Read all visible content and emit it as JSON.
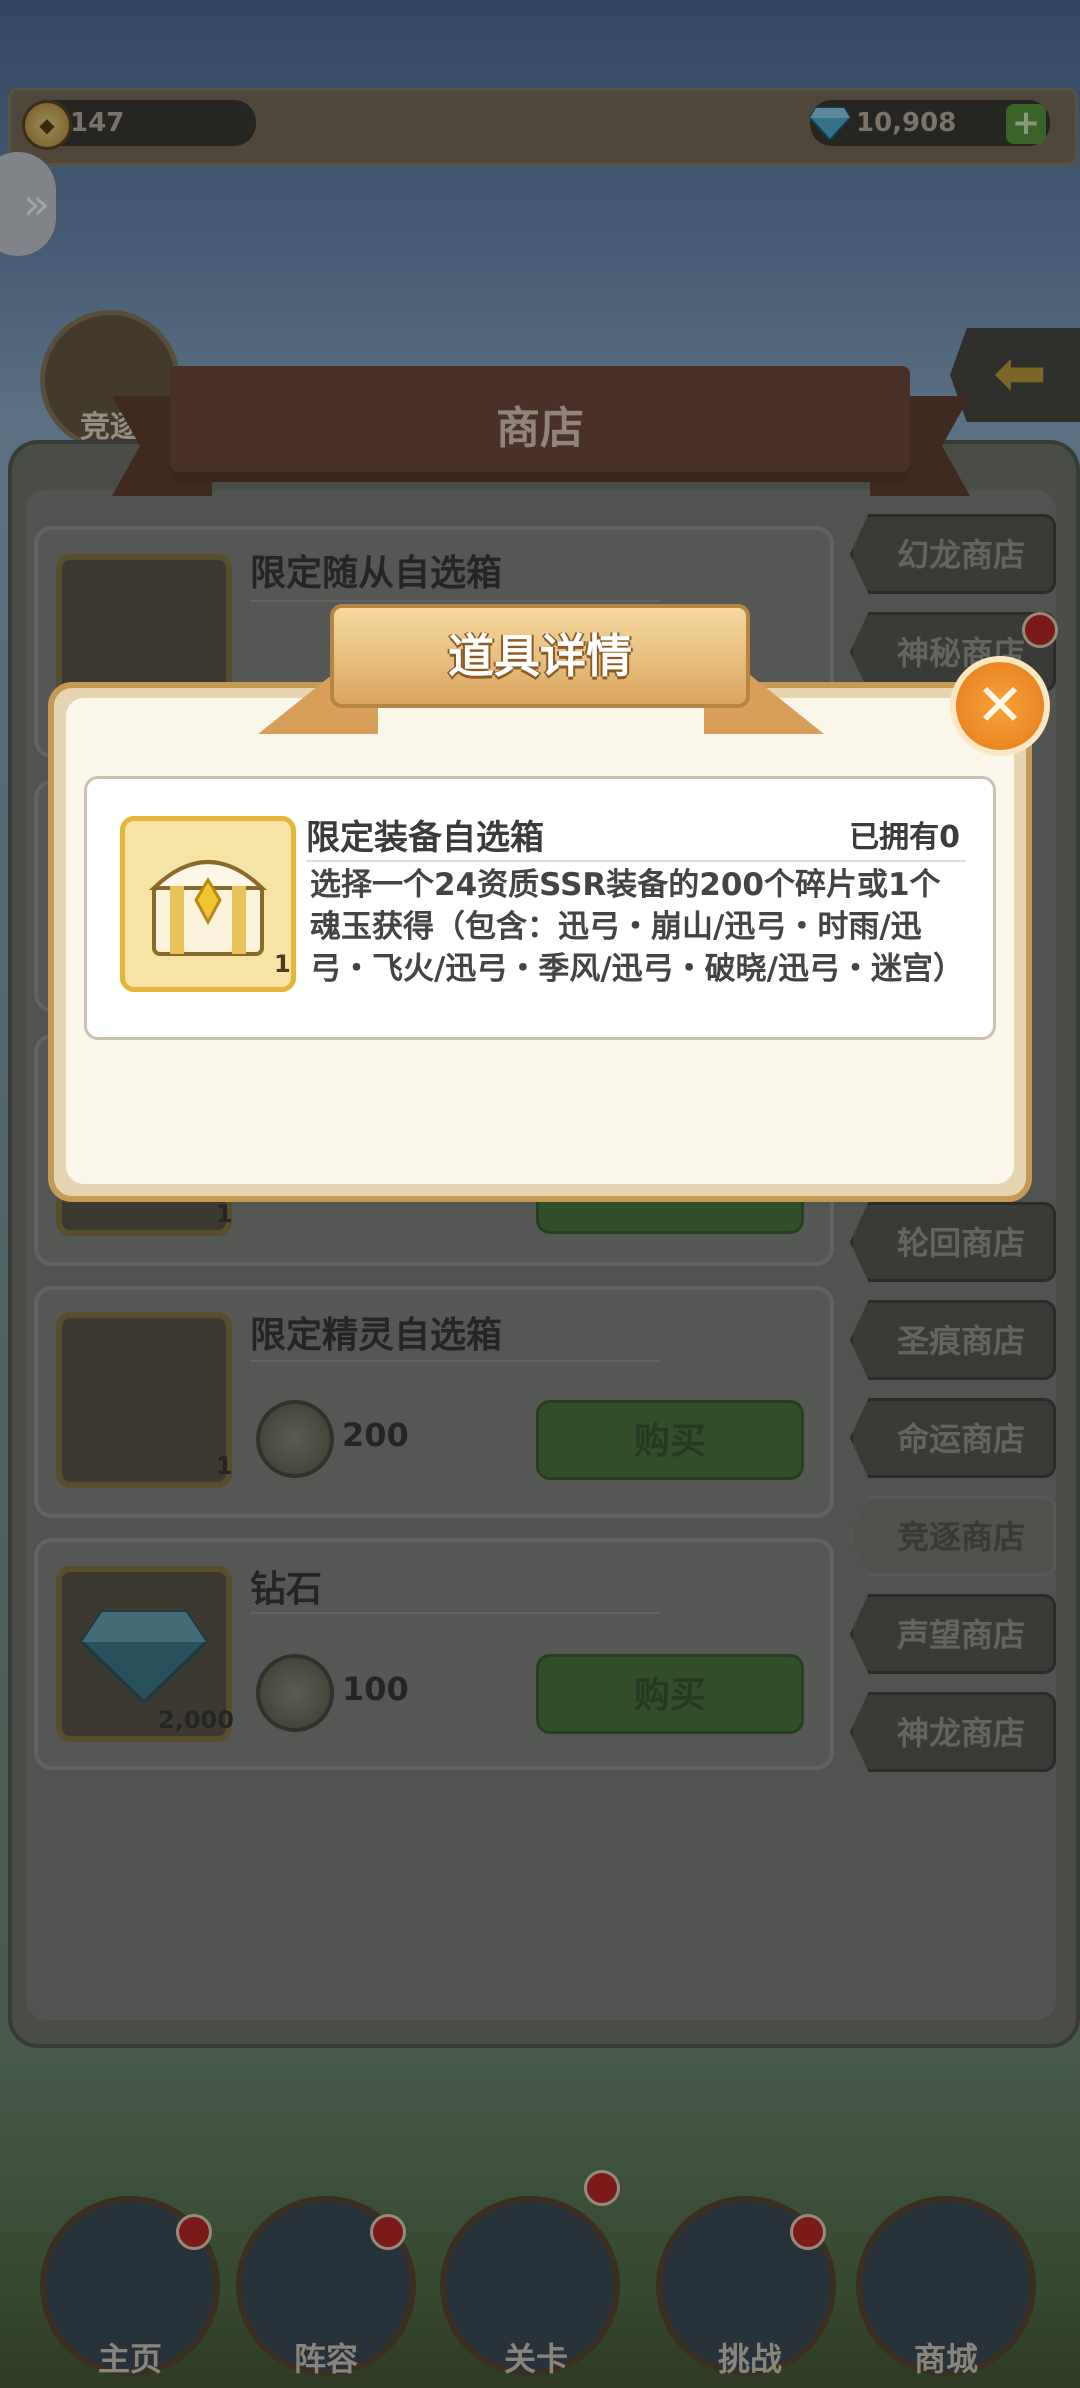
{
  "top_bar": {
    "currency_1": "147",
    "currency_2": "10,908",
    "add_symbol": "+"
  },
  "compete_badge_label": "竞逐",
  "shop": {
    "title": "商店",
    "items": [
      {
        "name": "限定随从自选箱"
      },
      {
        "name": "限定精灵自选箱",
        "qty": "1",
        "price": "200",
        "buy_label": "购买"
      },
      {
        "name": "钻石",
        "qty": "2,000",
        "price": "100",
        "buy_label": "购买"
      }
    ],
    "hidden_item_qty": "1"
  },
  "tabs": [
    {
      "label": "幻龙商店"
    },
    {
      "label": "神秘商店"
    },
    {
      "label": "轮回商店"
    },
    {
      "label": "圣痕商店"
    },
    {
      "label": "命运商店"
    },
    {
      "label": "竞逐商店"
    },
    {
      "label": "声望商店"
    },
    {
      "label": "神龙商店"
    }
  ],
  "modal": {
    "title": "道具详情",
    "item_name": "限定装备自选箱",
    "owned": "已拥有0",
    "description": "选择一个24资质SSR装备的200个碎片或1个魂玉获得（包含：迅弓・崩山/迅弓・时雨/迅弓・飞火/迅弓・季风/迅弓・破晓/迅弓・迷宫）",
    "item_qty": "1",
    "close_symbol": "✕"
  },
  "bottom_nav": [
    {
      "label": "主页"
    },
    {
      "label": "阵容"
    },
    {
      "label": "关卡"
    },
    {
      "label": "挑战"
    },
    {
      "label": "商城"
    }
  ],
  "colors": {
    "accent_orange": "#e67b18",
    "buy_green": "#4f7c42",
    "badge_red": "#c32a2a"
  }
}
